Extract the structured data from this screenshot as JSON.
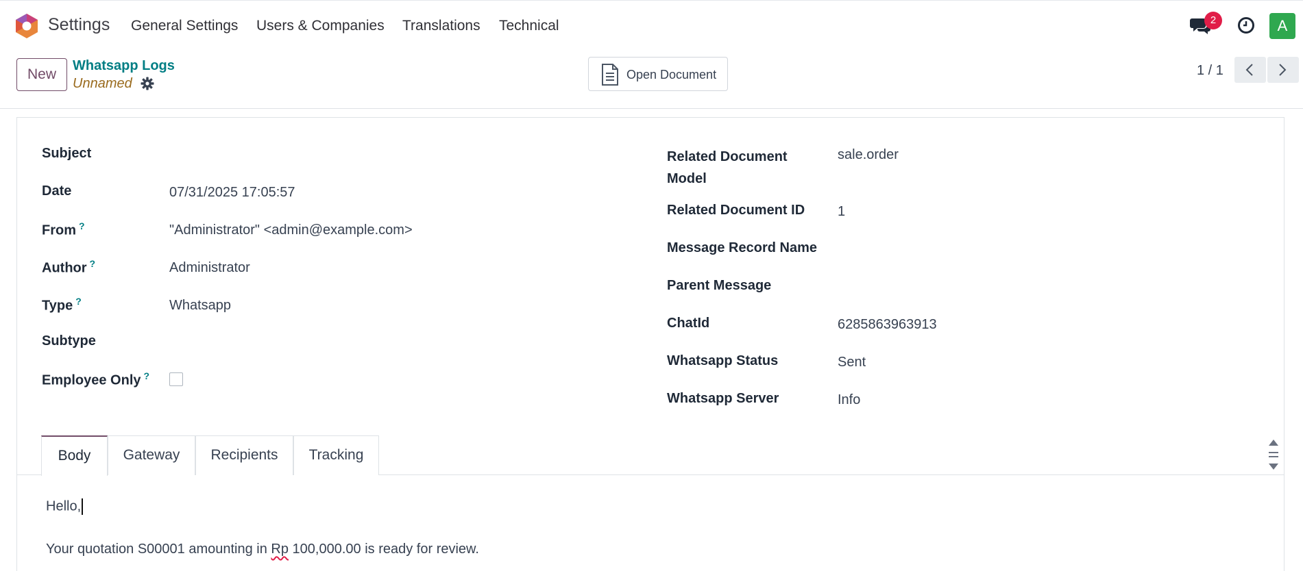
{
  "nav": {
    "app_title": "Settings",
    "menu": [
      "General Settings",
      "Users & Companies",
      "Translations",
      "Technical"
    ],
    "chat_badge": "2",
    "avatar_letter": "A"
  },
  "control": {
    "new_label": "New",
    "breadcrumb": "Whatsapp Logs",
    "record_name": "Unnamed",
    "open_document_label": "Open Document",
    "pager": "1 / 1"
  },
  "form": {
    "left": [
      {
        "label": "Subject",
        "value": ""
      },
      {
        "label": "Date",
        "value": "07/31/2025 17:05:57"
      },
      {
        "label": "From",
        "help": "?",
        "value": "\"Administrator\" <admin@example.com>"
      },
      {
        "label": "Author",
        "help": "?",
        "value": "Administrator"
      },
      {
        "label": "Type",
        "help": "?",
        "value": "Whatsapp"
      },
      {
        "label": "Subtype",
        "value": ""
      },
      {
        "label": "Employee Only",
        "help": "?",
        "checked": false
      }
    ],
    "right": [
      {
        "label_line1": "Related Document",
        "label_line2": "Model",
        "value": "sale.order"
      },
      {
        "label": "Related Document ID",
        "value": "1"
      },
      {
        "label": "Message Record Name",
        "value": ""
      },
      {
        "label": "Parent Message",
        "value": ""
      },
      {
        "label": "ChatId",
        "value": "6285863963913"
      },
      {
        "label": "Whatsapp Status",
        "value": "Sent"
      },
      {
        "label": "Whatsapp Server",
        "value": "Info"
      }
    ]
  },
  "tabs": [
    "Body",
    "Gateway",
    "Recipients",
    "Tracking"
  ],
  "body": {
    "line1": "Hello,",
    "line2_before": "Your quotation S00001 amounting in ",
    "line2_misspelled": "Rp",
    "line2_after": " 100,000.00 is ready for review."
  },
  "colors": {
    "brand": "#714b67",
    "link": "#017e84",
    "record_name": "#9a6b1e",
    "badge": "#e11d48",
    "avatar": "#2fa84f"
  }
}
